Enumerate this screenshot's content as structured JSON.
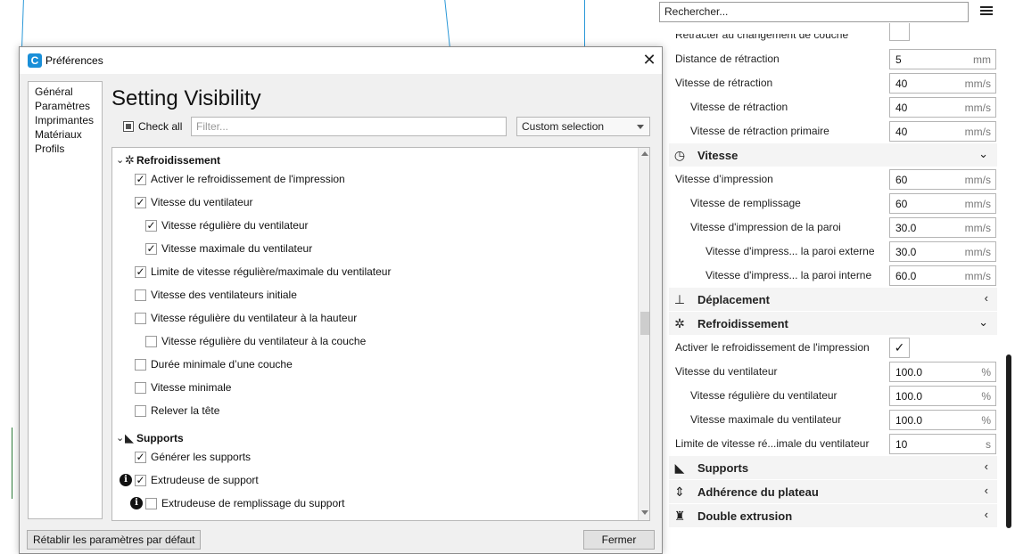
{
  "panel": {
    "search_placeholder": "Rechercher...",
    "partial_label": "Rétracter au changement de couche",
    "rows_top": [
      {
        "label": "Distance de rétraction",
        "value": "5",
        "unit": "mm"
      },
      {
        "label": "Vitesse de rétraction",
        "value": "40",
        "unit": "mm/s"
      },
      {
        "label": "Vitesse de rétraction",
        "value": "40",
        "unit": "mm/s"
      },
      {
        "label": "Vitesse de rétraction primaire",
        "value": "40",
        "unit": "mm/s"
      }
    ],
    "cat_vitesse": {
      "title": "Vitesse",
      "arrow": "expanded"
    },
    "rows_vitesse": [
      {
        "label": "Vitesse d’impression",
        "value": "60",
        "unit": "mm/s"
      },
      {
        "label": "Vitesse de remplissage",
        "value": "60",
        "unit": "mm/s"
      },
      {
        "label": "Vitesse d'impression de la paroi",
        "value": "30.0",
        "unit": "mm/s"
      },
      {
        "label": "Vitesse d'impress... la paroi externe",
        "value": "30.0",
        "unit": "mm/s"
      },
      {
        "label": "Vitesse d'impress... la paroi interne",
        "value": "60.0",
        "unit": "mm/s"
      }
    ],
    "cat_deplacement": {
      "title": "Déplacement"
    },
    "cat_refroid": {
      "title": "Refroidissement"
    },
    "row_cooling_enable": {
      "label": "Activer le refroidissement de l'impression",
      "check": "✓"
    },
    "rows_refroid": [
      {
        "label": "Vitesse du ventilateur",
        "value": "100.0",
        "unit": "%"
      },
      {
        "label": "Vitesse régulière du ventilateur",
        "value": "100.0",
        "unit": "%"
      },
      {
        "label": "Vitesse maximale du ventilateur",
        "value": "100.0",
        "unit": "%"
      },
      {
        "label": "Limite de vitesse ré...imale du ventilateur",
        "value": "10",
        "unit": "s"
      }
    ],
    "cat_supports": {
      "title": "Supports"
    },
    "cat_adherence": {
      "title": "Adhérence du plateau"
    },
    "cat_double": {
      "title": "Double extrusion"
    }
  },
  "dialog": {
    "title": "Préférences",
    "nav": [
      "Général",
      "Paramètres",
      "Imprimantes",
      "Matériaux",
      "Profils"
    ],
    "heading": "Setting Visibility",
    "check_all_label": "Check all",
    "filter_placeholder": "Filter...",
    "combo_value": "Custom selection",
    "cat_refroid": "Refroidissement",
    "cat_supports": "Supports",
    "items_refroid": [
      {
        "label": "Activer le refroidissement de l'impression",
        "checked": "✓"
      },
      {
        "label": "Vitesse du ventilateur",
        "checked": "✓"
      },
      {
        "label": "Vitesse régulière du ventilateur",
        "checked": "✓"
      },
      {
        "label": "Vitesse maximale du ventilateur",
        "checked": "✓"
      },
      {
        "label": "Limite de vitesse régulière/maximale du ventilateur",
        "checked": "✓"
      },
      {
        "label": "Vitesse des ventilateurs initiale",
        "checked": ""
      },
      {
        "label": "Vitesse régulière du ventilateur à la hauteur",
        "checked": ""
      },
      {
        "label": "Vitesse régulière du ventilateur à la couche",
        "checked": ""
      },
      {
        "label": "Durée minimale d’une couche",
        "checked": ""
      },
      {
        "label": "Vitesse minimale",
        "checked": ""
      },
      {
        "label": "Relever la tête",
        "checked": ""
      }
    ],
    "items_supports": [
      {
        "label": "Générer les supports",
        "checked": "✓"
      },
      {
        "label": "Extrudeuse de support",
        "checked": "✓"
      },
      {
        "label": "Extrudeuse de remplissage du support",
        "checked": ""
      }
    ],
    "info_glyph": "i",
    "reset_button": "Rétablir les paramètres par défaut",
    "close_button": "Fermer"
  }
}
